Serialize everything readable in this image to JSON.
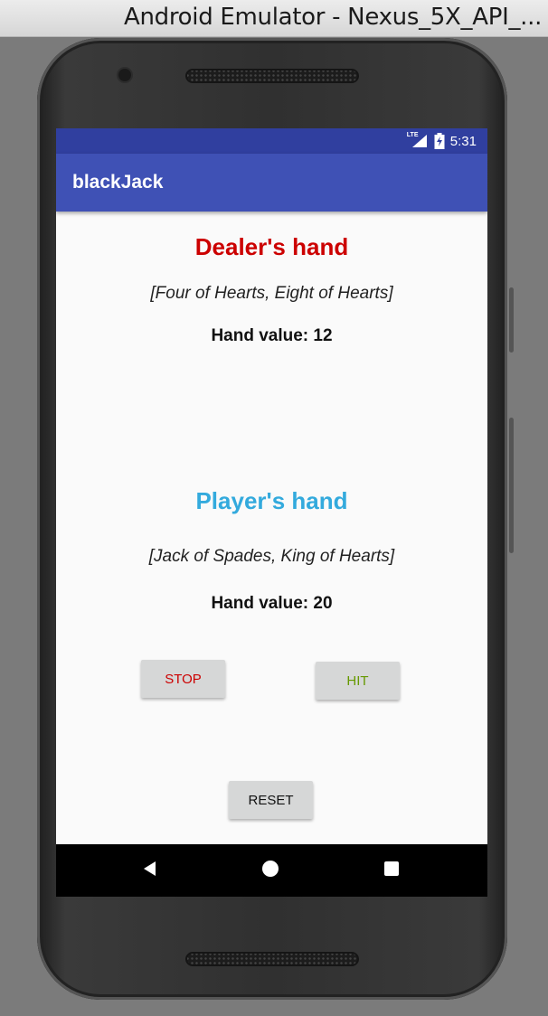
{
  "window": {
    "title": "Android Emulator - Nexus_5X_API_..."
  },
  "status_bar": {
    "network_label": "LTE",
    "time": "5:31"
  },
  "app_bar": {
    "title": "blackJack"
  },
  "dealer": {
    "heading": "Dealer's hand",
    "cards": "[Four of Hearts, Eight of Hearts]",
    "value_text": "Hand value: 12",
    "heading_color": "#cc0000"
  },
  "player": {
    "heading": "Player's hand",
    "cards": "[Jack of Spades, King of Hearts]",
    "value_text": "Hand value: 20",
    "heading_color": "#33aadd"
  },
  "buttons": {
    "stop_label": "STOP",
    "stop_color": "#cc0000",
    "hit_label": "HIT",
    "hit_color": "#669900",
    "reset_label": "RESET"
  },
  "nav": {
    "back_icon": "back-triangle-icon",
    "home_icon": "home-circle-icon",
    "recents_icon": "recents-square-icon"
  }
}
